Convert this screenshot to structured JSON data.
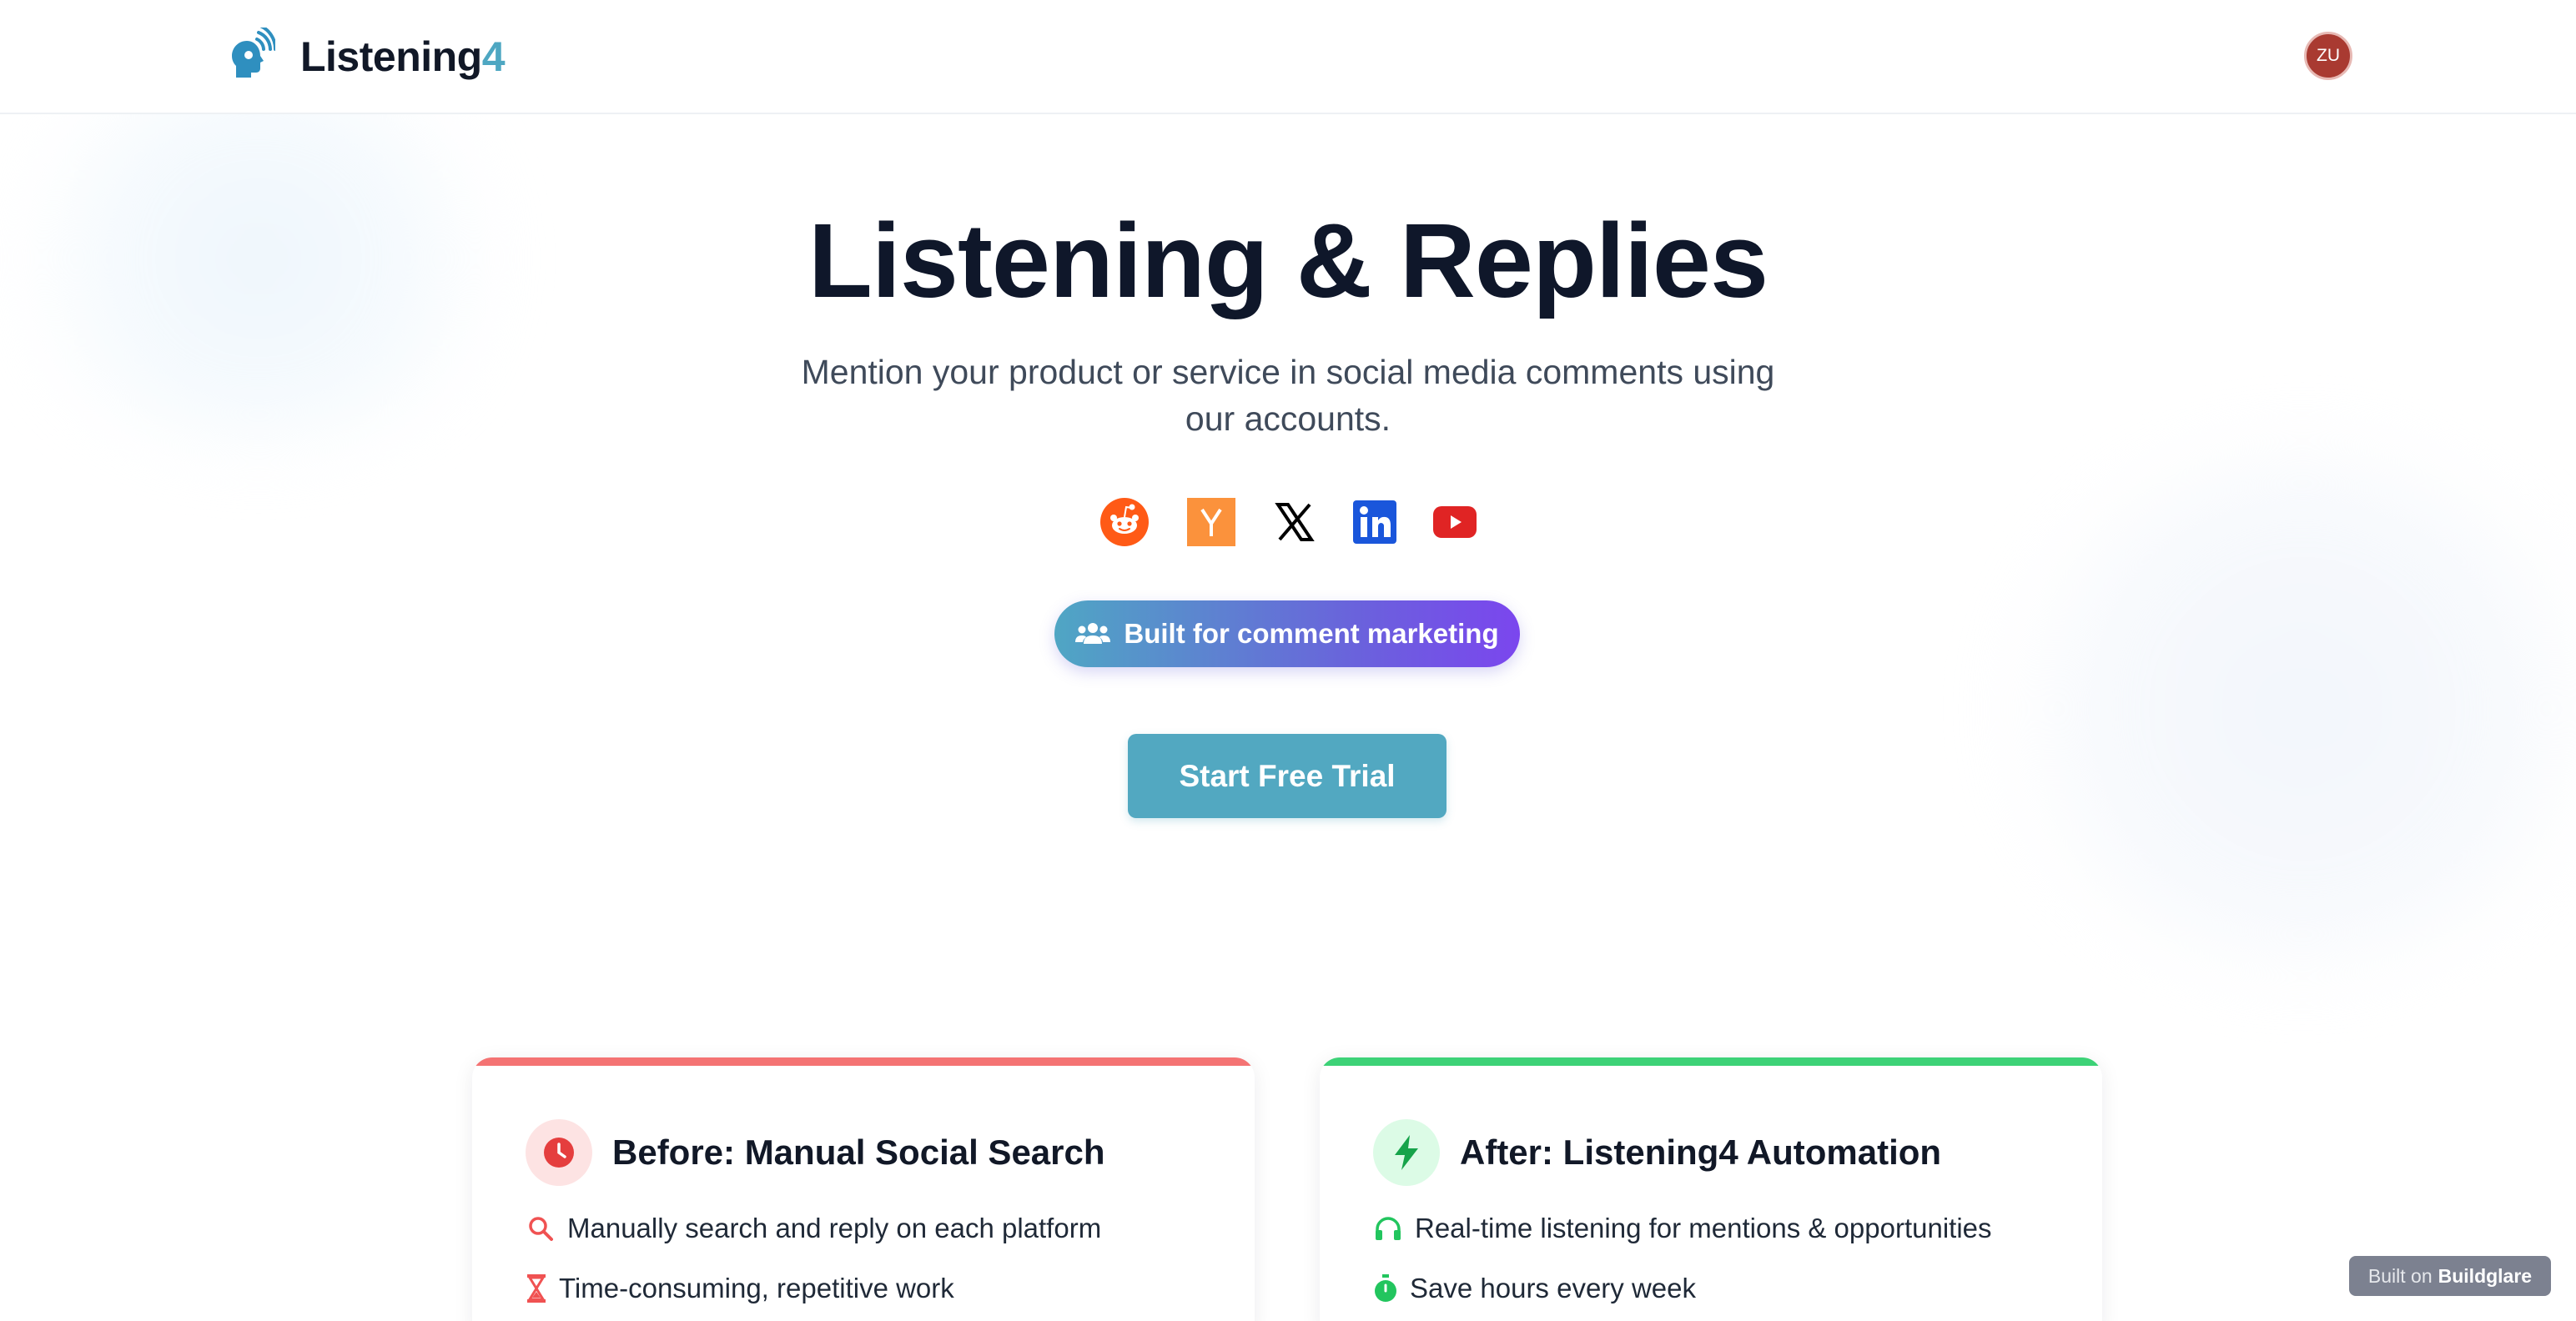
{
  "header": {
    "brand_name": "Listening",
    "brand_suffix": "4",
    "avatar_initials": "ZU"
  },
  "hero": {
    "title": "Listening & Replies",
    "subtitle": "Mention your product or service in social media comments using our accounts.",
    "platform_icons": [
      "reddit-icon",
      "hacker-news-icon",
      "x-icon",
      "linkedin-icon",
      "youtube-icon"
    ],
    "badge_label": "Built for comment marketing",
    "cta_label": "Start Free Trial"
  },
  "cards": {
    "before": {
      "title": "Before: Manual Social Search",
      "items": [
        {
          "icon": "search-icon",
          "text": "Manually search and reply on each platform"
        },
        {
          "icon": "hourglass-icon",
          "text": "Time-consuming, repetitive work"
        }
      ]
    },
    "after": {
      "title": "After: Listening4 Automation",
      "items": [
        {
          "icon": "headphones-icon",
          "text": "Real-time listening for mentions & opportunities"
        },
        {
          "icon": "stopwatch-icon",
          "text": "Save hours every week"
        }
      ]
    }
  },
  "footer_badge": {
    "prefix": "Built on",
    "brand": "Buildglare"
  },
  "colors": {
    "accent": "#52a8c1",
    "title": "#0f172a",
    "before_accent": "#f47373",
    "after_accent": "#3dd277",
    "badge_gradient_end": "#7b46ee"
  }
}
